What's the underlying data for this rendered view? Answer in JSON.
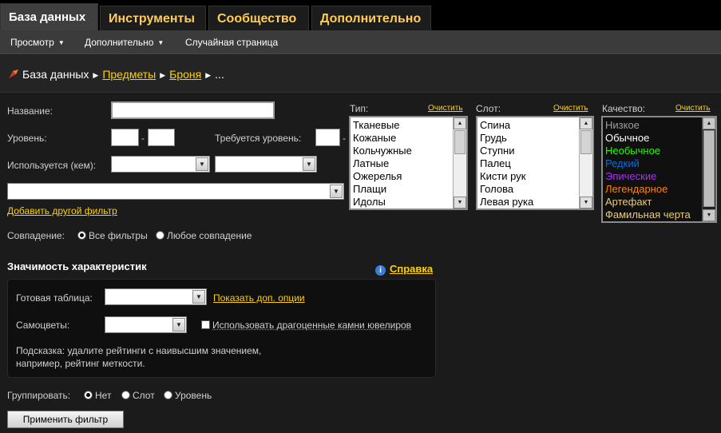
{
  "tabs": [
    {
      "label": "База данных",
      "active": true
    },
    {
      "label": "Инструменты",
      "active": false
    },
    {
      "label": "Сообщество",
      "active": false
    },
    {
      "label": "Дополнительно",
      "active": false
    }
  ],
  "subnav": [
    {
      "label": "Просмотр",
      "dropdown": true
    },
    {
      "label": "Дополнительно",
      "dropdown": true
    },
    {
      "label": "Случайная страница",
      "dropdown": false
    }
  ],
  "breadcrumb": {
    "root": "База данных",
    "items": [
      "Предметы",
      "Броня"
    ],
    "more": "..."
  },
  "filters": {
    "name_label": "Название:",
    "name_value": "",
    "level_label": "Уровень:",
    "level_dash": "-",
    "req_level_label": "Требуется уровень:",
    "req_level_dash": "-",
    "used_by_label": "Используется (кем):",
    "add_filter_link": "Добавить другой фильтр",
    "match_label": "Совпадение:",
    "match_all": "Все фильтры",
    "match_any": "Любое совпадение"
  },
  "lists": {
    "clear_label": "Очистить",
    "type": {
      "label": "Тип:",
      "items": [
        "Тканевые",
        "Кожаные",
        "Кольчужные",
        "Латные",
        "Ожерелья",
        "Плащи",
        "Идолы"
      ]
    },
    "slot": {
      "label": "Слот:",
      "items": [
        "Спина",
        "Грудь",
        "Ступни",
        "Палец",
        "Кисти рук",
        "Голова",
        "Левая рука"
      ]
    },
    "quality": {
      "label": "Качество:",
      "items": [
        {
          "label": "Низкое",
          "color": "#9d9d9d"
        },
        {
          "label": "Обычное",
          "color": "#ffffff"
        },
        {
          "label": "Необычное",
          "color": "#1eff00"
        },
        {
          "label": "Редкий",
          "color": "#0070dd"
        },
        {
          "label": "Эпические",
          "color": "#a335ee"
        },
        {
          "label": "Легендарное",
          "color": "#ff8000"
        },
        {
          "label": "Артефакт",
          "color": "#e6cc80"
        },
        {
          "label": "Фамильная черта",
          "color": "#e6cc80"
        }
      ]
    }
  },
  "weights": {
    "title": "Значимость характеристик",
    "help_link": "Справка",
    "preset_label": "Готовая таблица:",
    "show_options_link": "Показать доп. опции",
    "gems_label": "Самоцветы:",
    "jc_gems_label": "Использовать драгоценные камни ювелиров",
    "hint_line1": "Подсказка: удалите рейтинги с наивысшим значением,",
    "hint_line2": "например, рейтинг меткости."
  },
  "grouping": {
    "label": "Группировать:",
    "none": "Нет",
    "slot": "Слот",
    "level": "Уровень"
  },
  "apply_button": "Применить фильтр",
  "colors": {
    "accent": "#ffd100",
    "tab_accent": "#ffcd55"
  }
}
